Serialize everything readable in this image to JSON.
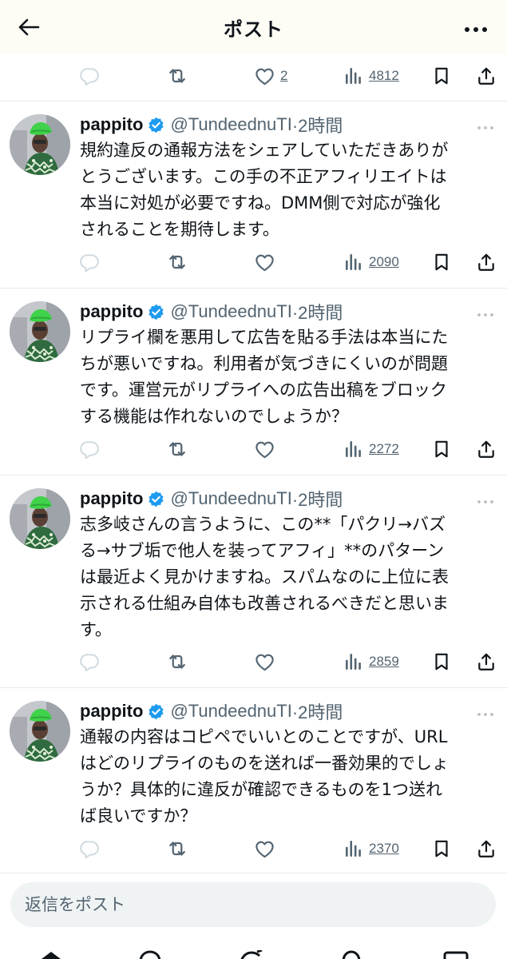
{
  "header": {
    "title": "ポスト",
    "back_icon": "arrow-left-icon",
    "more_icon": "more-horizontal-icon"
  },
  "top_actions": {
    "like_count": "2",
    "view_count": "4812"
  },
  "replies": [
    {
      "display_name": "pappito",
      "handle": "@TundeednuTI",
      "time": "·2時間",
      "text": "規約違反の通報方法をシェアしていただきありが\nとうございます。この手の不正アフィリエイトは\n本当に対処が必要ですね。DMM側で対応が強化\nされることを期待します。",
      "view_count": "2090"
    },
    {
      "display_name": "pappito",
      "handle": "@TundeednuTI",
      "time": "·2時間",
      "text": "リプライ欄を悪用して広告を貼る手法は本当にた\nちが悪いですね。利用者が気づきにくいのが問題\nです。運営元がリプライへの広告出稿をブロック\nする機能は作れないのでしょうか？",
      "view_count": "2272"
    },
    {
      "display_name": "pappito",
      "handle": "@TundeednuTI",
      "time": "·2時間",
      "text": "志多岐さんの言うように、この**「パクリ→バズ\nる→サブ垢で他人を装ってアフィ」**のパターン\nは最近よく見かけますね。スパムなのに上位に表\n示される仕組み自体も改善されるべきだと思いま\nす。",
      "view_count": "2859"
    },
    {
      "display_name": "pappito",
      "handle": "@TundeednuTI",
      "time": "·2時間",
      "text": "通報の内容はコピペでいいとのことですが、URL\nはどのリプライのものを送れば一番効果的でしょ\nうか？具体的に違反が確認できるものを1つ送れ\nば良いですか？",
      "view_count": "2370"
    }
  ],
  "composer": {
    "placeholder": "返信をポスト"
  },
  "colors": {
    "text": "#0f1419",
    "secondary": "#536471",
    "verified": "#1d9bf0",
    "header_bg": "#fdfdf5",
    "composer_bg": "#eff3f4"
  }
}
